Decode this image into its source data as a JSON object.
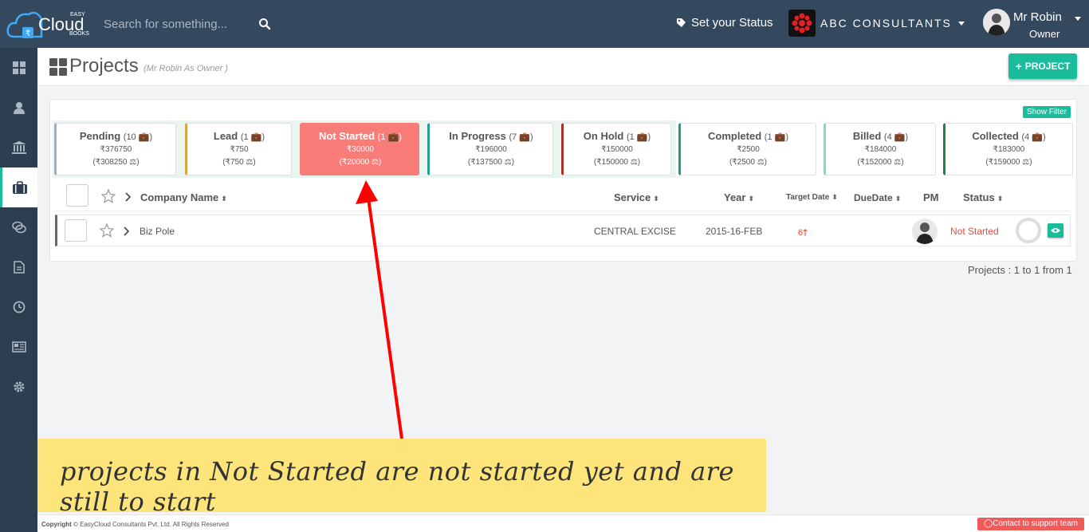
{
  "topbar": {
    "logo_text": "Cloud",
    "logo_small_top": "EASY",
    "logo_small_bottom": "BOOKS",
    "search_placeholder": "Search for something...",
    "status_label": "Set your Status",
    "company_name": "ABC CONSULTANTS",
    "user_name": "Mr Robin",
    "user_role": "Owner"
  },
  "header": {
    "title": "Projects",
    "subtitle": "(Mr Robin As Owner )",
    "add_button": "PROJECT"
  },
  "filter_button": "Show Filter",
  "tabs": [
    {
      "name": "Pending",
      "count": "10",
      "amount": "₹376750",
      "balance": "(₹308250",
      "color": "#a0aec0"
    },
    {
      "name": "Lead",
      "count": "1",
      "amount": "₹750",
      "balance": "(₹750",
      "color": "#e0a045"
    },
    {
      "name": "Not Started",
      "count": "1",
      "amount": "₹30000",
      "balance": "(₹20000",
      "color": "#f87c78"
    },
    {
      "name": "In Progress",
      "count": "7",
      "amount": "₹196000",
      "balance": "(₹137500",
      "color": "#2a9d8f"
    },
    {
      "name": "On Hold",
      "count": "1",
      "amount": "₹150000",
      "balance": "(₹150000",
      "color": "#a93226"
    },
    {
      "name": "Completed",
      "count": "1",
      "amount": "₹2500",
      "balance": "(₹2500",
      "color": "#16a085"
    },
    {
      "name": "Billed",
      "count": "4",
      "amount": "₹184000",
      "balance": "(₹152000",
      "color": "#82e0aa"
    },
    {
      "name": "Collected",
      "count": "4",
      "amount": "₹183000",
      "balance": "(₹159000",
      "color": "#1e8449"
    }
  ],
  "table": {
    "headers": {
      "company": "Company Name",
      "service": "Service",
      "year": "Year",
      "target": "Target Date",
      "due": "DueDate",
      "pm": "PM",
      "status": "Status"
    },
    "rows": [
      {
        "company": "Biz Pole",
        "service": "CENTRAL EXCISE",
        "year": "2015-16-FEB",
        "target": "6",
        "status": "Not Started"
      }
    ]
  },
  "pagination": "Projects : 1 to 1 from 1",
  "annotation": "projects in Not Started are not started yet and are still to start",
  "footer": {
    "copyright_bold": "Copyright",
    "copyright": "© EasyCloud Consultants Pvt. Ltd. All Rights Reserved",
    "support": "Contact to support team"
  },
  "colors": {
    "accent": "#1abc9c",
    "active_tab": "#f87c78",
    "topbar": "#34495e",
    "annotation_bg": "#fde57c",
    "arrow": "#ff0000"
  }
}
